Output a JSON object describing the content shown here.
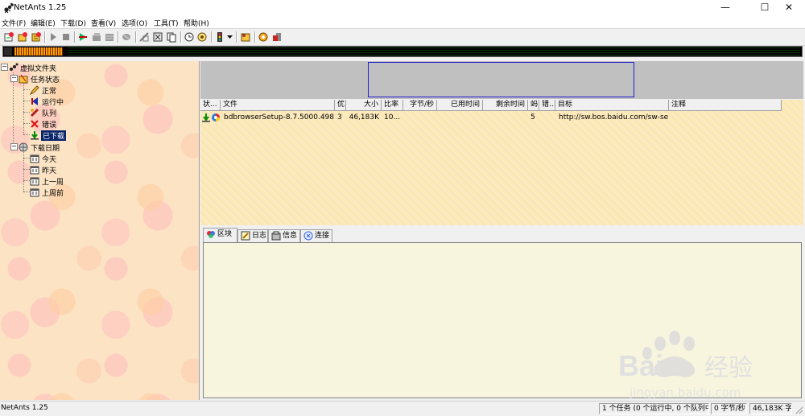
{
  "window": {
    "title": "NetAnts 1.25",
    "minimize": "—",
    "maximize": "☐",
    "close": "✕"
  },
  "menu": [
    "文件(F)",
    "编辑(E)",
    "下载(D)",
    "查看(V)",
    "选项(O)",
    "工具(T)",
    "帮助(H)"
  ],
  "toolbar_icons": [
    "new-task-icon",
    "open-icon",
    "paste-url-icon",
    "start-icon",
    "stop-icon",
    "download-all-icon",
    "pause-all-icon",
    "schedule-icon",
    "delete-icon",
    "properties-icon",
    "move-icon",
    "copy-icon",
    "options-icon",
    "timer-icon",
    "signal-icon",
    "dropdown-icon",
    "sound-icon",
    "settings-icon",
    "exit-icon"
  ],
  "tree": {
    "root": "虚拟文件夹",
    "task_status": "任务状态",
    "status_items": [
      "正常",
      "运行中",
      "队列",
      "错误",
      "已下载"
    ],
    "download_date": "下载日期",
    "date_items": [
      "今天",
      "昨天",
      "上一周",
      "上周前"
    ]
  },
  "columns": [
    "状...",
    "文件",
    "优",
    "大小",
    "比率",
    "字节/秒",
    "已用时间",
    "剩余时间",
    "蚂",
    "错...",
    "目标",
    "注释"
  ],
  "rows": [
    {
      "file": "bdbrowserSetup-8.7.5000.498...",
      "priority": "3",
      "size": "46,183K",
      "ratio": "10...",
      "bytes_sec": "",
      "elapsed": "",
      "remaining": "",
      "ants": "5",
      "errors": "",
      "target": "http://sw.bos.baidu.com/sw-se...",
      "notes": ""
    }
  ],
  "tabs": [
    "区块",
    "日志",
    "信息",
    "连接"
  ],
  "status": {
    "app": "NetAnts 1.25",
    "tasks": "1 个任务 (0 个运行中, 0 个队列中)",
    "speed": "0 字节/秒",
    "total": "46,183K 字节"
  },
  "watermark": {
    "brand": "Bai",
    "brand2": "经验",
    "url": "jingyan.baidu.com"
  }
}
